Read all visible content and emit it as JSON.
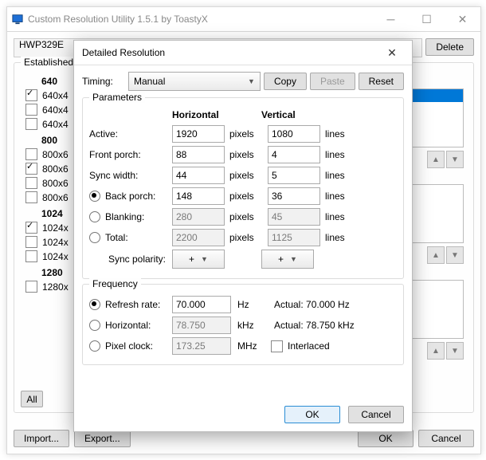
{
  "main_window": {
    "title": "Custom Resolution Utility 1.5.1 by ToastyX",
    "monitor_id": "HWP329E",
    "delete_btn": "Delete",
    "established_title": "Established",
    "all_btn": "All",
    "import_btn": "Import...",
    "export_btn": "Export...",
    "ok_btn": "OK",
    "cancel_btn": "Cancel",
    "resolutions": {
      "g640": "640",
      "g800": "800",
      "g1024": "1024",
      "g1280": "1280",
      "r640a": "640x4",
      "r640b": "640x4",
      "r640c": "640x4",
      "r800a": "800x6",
      "r800b": "800x6",
      "r800c": "800x6",
      "r800d": "800x6",
      "r1024a": "1024x",
      "r1024b": "1024x",
      "r1024c": "1024x",
      "r1280a": "1280x"
    }
  },
  "dialog": {
    "title": "Detailed Resolution",
    "timing_label": "Timing:",
    "timing_value": "Manual",
    "copy_btn": "Copy",
    "paste_btn": "Paste",
    "reset_btn": "Reset",
    "parameters_title": "Parameters",
    "col_horizontal": "Horizontal",
    "col_vertical": "Vertical",
    "rows": {
      "active_label": "Active:",
      "active_h": "1920",
      "active_v": "1080",
      "fporch_label": "Front porch:",
      "fporch_h": "88",
      "fporch_v": "4",
      "swidth_label": "Sync width:",
      "swidth_h": "44",
      "swidth_v": "5",
      "bporch_label": "Back porch:",
      "bporch_h": "148",
      "bporch_v": "36",
      "blank_label": "Blanking:",
      "blank_h": "280",
      "blank_v": "45",
      "total_label": "Total:",
      "total_h": "2200",
      "total_v": "1125",
      "pol_label": "Sync polarity:",
      "pol_h": "+",
      "pol_v": "+"
    },
    "unit_pixels": "pixels",
    "unit_lines": "lines",
    "frequency_title": "Frequency",
    "freq": {
      "refresh_label": "Refresh rate:",
      "refresh_val": "70.000",
      "refresh_unit": "Hz",
      "refresh_actual": "Actual: 70.000 Hz",
      "horiz_label": "Horizontal:",
      "horiz_val": "78.750",
      "horiz_unit": "kHz",
      "horiz_actual": "Actual: 78.750 kHz",
      "pclk_label": "Pixel clock:",
      "pclk_val": "173.25",
      "pclk_unit": "MHz",
      "interlaced_label": "Interlaced"
    },
    "ok_btn": "OK",
    "cancel_btn": "Cancel"
  }
}
